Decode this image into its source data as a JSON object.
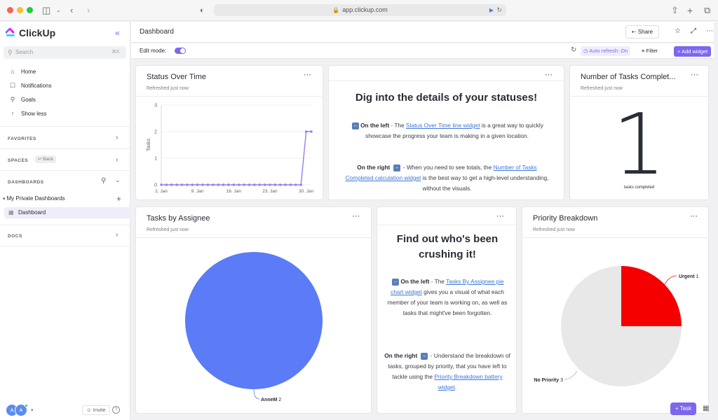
{
  "browser": {
    "url": "app.clickup.com"
  },
  "sidebar": {
    "brand": "ClickUp",
    "search_placeholder": "Search",
    "search_shortcut": "⌘K",
    "nav": [
      {
        "label": "Home",
        "icon": "home-icon"
      },
      {
        "label": "Notifications",
        "icon": "bell-icon"
      },
      {
        "label": "Goals",
        "icon": "trophy-icon"
      },
      {
        "label": "Show less",
        "icon": "arrow-up-icon"
      }
    ],
    "favorites_label": "FAVORITES",
    "spaces_label": "SPACES",
    "back_label": "Back",
    "dashboards_label": "DASHBOARDS",
    "private_dashboards_label": "My Private Dashboards",
    "dashboard_item_label": "Dashboard",
    "docs_label": "DOCS",
    "avatar_initials": [
      "A",
      "A"
    ],
    "invite_label": "Invite",
    "help_label": "?"
  },
  "header": {
    "title": "Dashboard",
    "share_label": "Share"
  },
  "toolbar": {
    "edit_mode_label": "Edit mode:",
    "edit_mode_on": true,
    "auto_refresh_label": "Auto refresh: On",
    "filter_label": "Filter",
    "add_widget_label": "Add widget"
  },
  "widgets": {
    "status_over_time": {
      "title": "Status Over Time",
      "subtitle": "Refreshed just now"
    },
    "statuses_text": {
      "heading": "Dig into the details of your statuses!",
      "p1_bold": "On the left",
      "p1_pre": " - The ",
      "p1_link": "Status Over Time line widget",
      "p1_post": " is a great way to quickly showcase the progress your team is making in a given location.",
      "p2_bold": "On the right",
      "p2_pre": " - When you need to see totals, the ",
      "p2_link": "Number of Tasks Completed calculation widget",
      "p2_post": " is the best way to get a high-level understanding, without the visuals."
    },
    "tasks_completed": {
      "title": "Number of Tasks Complet...",
      "subtitle": "Refreshed just now",
      "value": "1",
      "caption": "tasks completed"
    },
    "tasks_by_assignee": {
      "title": "Tasks by Assignee",
      "subtitle": "Refreshed just now"
    },
    "assignee_text": {
      "heading": "Find out who's been crushing it!",
      "p1_bold": "On the left",
      "p1_pre": " - The ",
      "p1_link": "Tasks By Assignee pie chart widget",
      "p1_post": " gives you a visual of what each member of your team is working on, as well as tasks that might've been forgotten.",
      "p2_bold": "On the right",
      "p2_pre": " - Understand the breakdown of tasks, grouped by priority, that you have left to tackle using the ",
      "p2_link": "Priority Breakdown battery widget",
      "p2_post": "."
    },
    "priority_breakdown": {
      "title": "Priority Breakdown",
      "subtitle": "Refreshed just now"
    }
  },
  "fab": {
    "task_label": "Task"
  },
  "colors": {
    "accent": "#7b68ee",
    "line": "#9b7de8",
    "assignee_pie": "#5b7cf6",
    "urgent": "#f50000",
    "no_priority": "#e8e8e8"
  },
  "chart_data": [
    {
      "type": "line",
      "x": [
        "2. Jan",
        "3. Jan",
        "4. Jan",
        "5. Jan",
        "6. Jan",
        "7. Jan",
        "8. Jan",
        "9. Jan",
        "10. Jan",
        "11. Jan",
        "12. Jan",
        "13. Jan",
        "14. Jan",
        "15. Jan",
        "16. Jan",
        "17. Jan",
        "18. Jan",
        "19. Jan",
        "20. Jan",
        "21. Jan",
        "22. Jan",
        "23. Jan",
        "24. Jan",
        "25. Jan",
        "26. Jan",
        "27. Jan",
        "28. Jan",
        "29. Jan",
        "30. Jan",
        "31. Jan"
      ],
      "xticks": [
        "2. Jan",
        "9. Jan",
        "16. Jan",
        "23. Jan",
        "30. Jan"
      ],
      "series": [
        {
          "values": [
            0,
            0,
            0,
            0,
            0,
            0,
            0,
            0,
            0,
            0,
            0,
            0,
            0,
            0,
            0,
            0,
            0,
            0,
            0,
            0,
            0,
            0,
            0,
            0,
            0,
            0,
            0,
            0,
            2,
            2
          ]
        }
      ],
      "ylabel": "Tasks",
      "ylim": [
        0,
        3
      ],
      "yticks": [
        "0",
        "1",
        "2",
        "3"
      ]
    },
    {
      "type": "pie",
      "labels": [
        "AnneM"
      ],
      "values": [
        2
      ]
    },
    {
      "type": "pie",
      "labels": [
        "Urgent",
        "No Priority"
      ],
      "values": [
        1,
        3
      ]
    }
  ]
}
